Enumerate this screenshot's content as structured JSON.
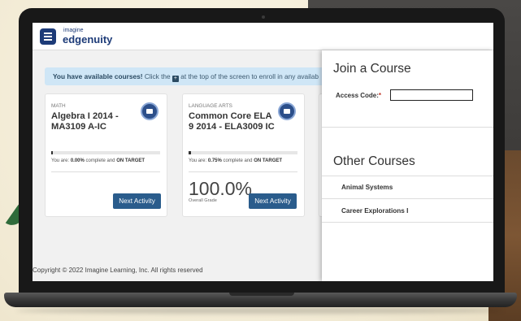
{
  "header": {
    "logo_small": "imagine",
    "logo_big": "edgenuity"
  },
  "banner": {
    "bold": "You have available courses!",
    "prefix": " Click the ",
    "suffix": " at the top of the screen to enroll in any availab"
  },
  "courses": [
    {
      "subject": "MATH",
      "title": "Algebra I 2014 - MA3109 A-IC",
      "progress_prefix": "You are: ",
      "progress_percent": "0.00%",
      "progress_middle": " complete and ",
      "progress_status": "ON TARGET",
      "progress_fraction": 0.0,
      "next_label": "Next Activity"
    },
    {
      "subject": "LANGUAGE ARTS",
      "title": "Common Core ELA 9 2014 - ELA3009 IC",
      "progress_prefix": "You are: ",
      "progress_percent": "0.75%",
      "progress_middle": " complete and ",
      "progress_status": "ON TARGET",
      "progress_fraction": 0.0075,
      "grade": "100.0%",
      "grade_label": "Overall Grade",
      "next_label": "Next Activity"
    }
  ],
  "footer": "Copyright © 2022 Imagine Learning, Inc. All rights reserved",
  "join": {
    "title": "Join a Course",
    "access_label": "Access Code:",
    "required_mark": "*",
    "access_value": ""
  },
  "other": {
    "title": "Other Courses",
    "items": [
      "Animal Systems",
      "Career Explorations I"
    ]
  }
}
